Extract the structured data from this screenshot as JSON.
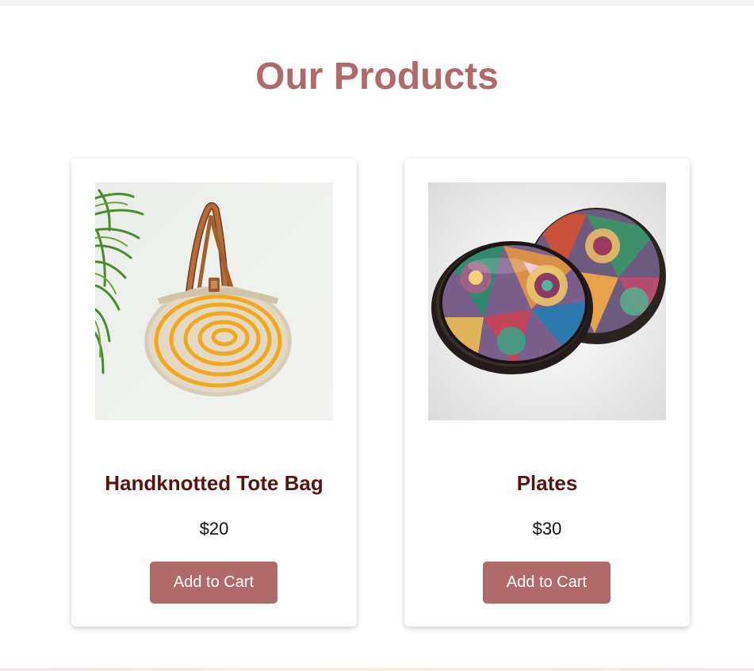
{
  "page": {
    "title": "Our Products"
  },
  "products": [
    {
      "name": "Handknotted Tote Bag",
      "price": "$20",
      "button_label": "Add to Cart",
      "image_icon": "tote-bag-image"
    },
    {
      "name": "Plates",
      "price": "$30",
      "button_label": "Add to Cart",
      "image_icon": "plates-image"
    }
  ],
  "colors": {
    "title": "#b06a6a",
    "product_name": "#5a1410",
    "button_bg": "#b06a6a",
    "button_text": "#ffffff"
  }
}
